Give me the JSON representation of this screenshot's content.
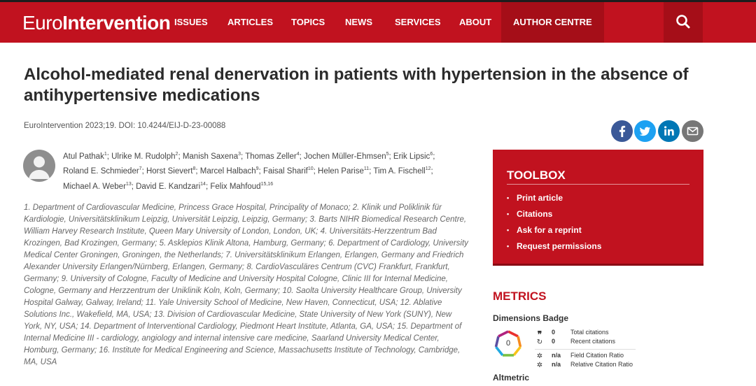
{
  "header": {
    "logo_part1": "Euro",
    "logo_part2": "Intervention",
    "nav": [
      "ISSUES",
      "ARTICLES",
      "TOPICS",
      "NEWS",
      "SERVICES",
      "ABOUT",
      "AUTHOR CENTRE"
    ],
    "search_icon": "search-icon"
  },
  "article": {
    "title": "Alcohol-mediated renal denervation in patients with hypertension in the absence of antihypertensive medications",
    "citation": "EuroIntervention 2023;19. DOI: 10.4244/EIJ-D-23-00088",
    "authors": [
      {
        "name": "Atul Pathak",
        "sup": "1"
      },
      {
        "name": "Ulrike M. Rudolph",
        "sup": "2"
      },
      {
        "name": "Manish Saxena",
        "sup": "3"
      },
      {
        "name": "Thomas Zeller",
        "sup": "4"
      },
      {
        "name": "Jochen Müller-Ehmsen",
        "sup": "5"
      },
      {
        "name": "Erik Lipsic",
        "sup": "6"
      },
      {
        "name": "Roland E. Schmieder",
        "sup": "7"
      },
      {
        "name": "Horst Sievert",
        "sup": "8"
      },
      {
        "name": "Marcel Halbach",
        "sup": "9"
      },
      {
        "name": "Faisal Sharif",
        "sup": "10"
      },
      {
        "name": "Helen Parise",
        "sup": "11"
      },
      {
        "name": "Tim A. Fischell",
        "sup": "12"
      },
      {
        "name": "Michael A. Weber",
        "sup": "13"
      },
      {
        "name": "David E. Kandzari",
        "sup": "14"
      },
      {
        "name": "Felix Mahfoud",
        "sup": "15,16"
      }
    ],
    "affiliations": "1. Department of Cardiovascular Medicine, Princess Grace Hospital, Principality of Monaco; 2. Klinik und Poliklinik für Kardiologie, Universitätsklinikum Leipzig, Universität Leipzig, Leipzig, Germany; 3. Barts NIHR Biomedical Research Centre, William Harvey Research Institute, Queen Mary University of London, London, UK; 4. Universitäts-Herzzentrum Bad Krozingen, Bad Krozingen, Germany; 5. Asklepios Klinik Altona, Hamburg, Germany; 6. Department of Cardiology, University Medical Center Groningen, Groningen, the Netherlands; 7. Universitätsklinikum Erlangen, Erlangen, Germany and Friedrich Alexander University Erlangen/Nürnberg, Erlangen, Germany; 8. CardioVasculäres Centrum (CVC) Frankfurt, Frankfurt, Germany; 9. University of Cologne, Faculty of Medicine and University Hospital Cologne, Clinic III for Internal Medicine, Cologne, Germany and Herzzentrum der Uniklinik Koln, Koln, Germany; 10. Saolta University Healthcare Group, University Hospital Galway, Galway, Ireland; 11. Yale University School of Medicine, New Haven, Connecticut, USA; 12. Ablative Solutions Inc., Wakefield, MA, USA; 13. Division of Cardiovascular Medicine, State University of New York (SUNY), New York, NY, USA; 14. Department of Interventional Cardiology, Piedmont Heart Institute, Atlanta, GA, USA; 15. Department of Internal Medicine III - cardiology, angiology and internal intensive care medicine, Saarland University Medical Center, Homburg, Germany; 16. Institute for Medical Engineering and Science, Massachusetts Institute of Technology, Cambridge, MA, USA"
  },
  "share": {
    "facebook_icon": "facebook-icon",
    "twitter_icon": "twitter-icon",
    "linkedin_icon": "linkedin-icon",
    "email_icon": "email-icon"
  },
  "toolbox": {
    "title": "TOOLBOX",
    "items": [
      "Print article",
      "Citations",
      "Ask for a reprint",
      "Request permissions"
    ]
  },
  "metrics": {
    "title": "METRICS",
    "dimensions_label": "Dimensions Badge",
    "badge_value": "0",
    "rows": [
      {
        "value": "0",
        "label": "Total citations"
      },
      {
        "value": "0",
        "label": "Recent citations"
      },
      {
        "value": "n/a",
        "label": "Field Citation Ratio"
      },
      {
        "value": "n/a",
        "label": "Relative Citation Ratio"
      }
    ],
    "altmetric_label": "Altmetric"
  },
  "colors": {
    "brand_red": "#c1121f",
    "dark_red": "#a50e18",
    "facebook": "#3b5998",
    "twitter": "#1da1f2",
    "linkedin": "#0077b5",
    "email": "#777777"
  }
}
